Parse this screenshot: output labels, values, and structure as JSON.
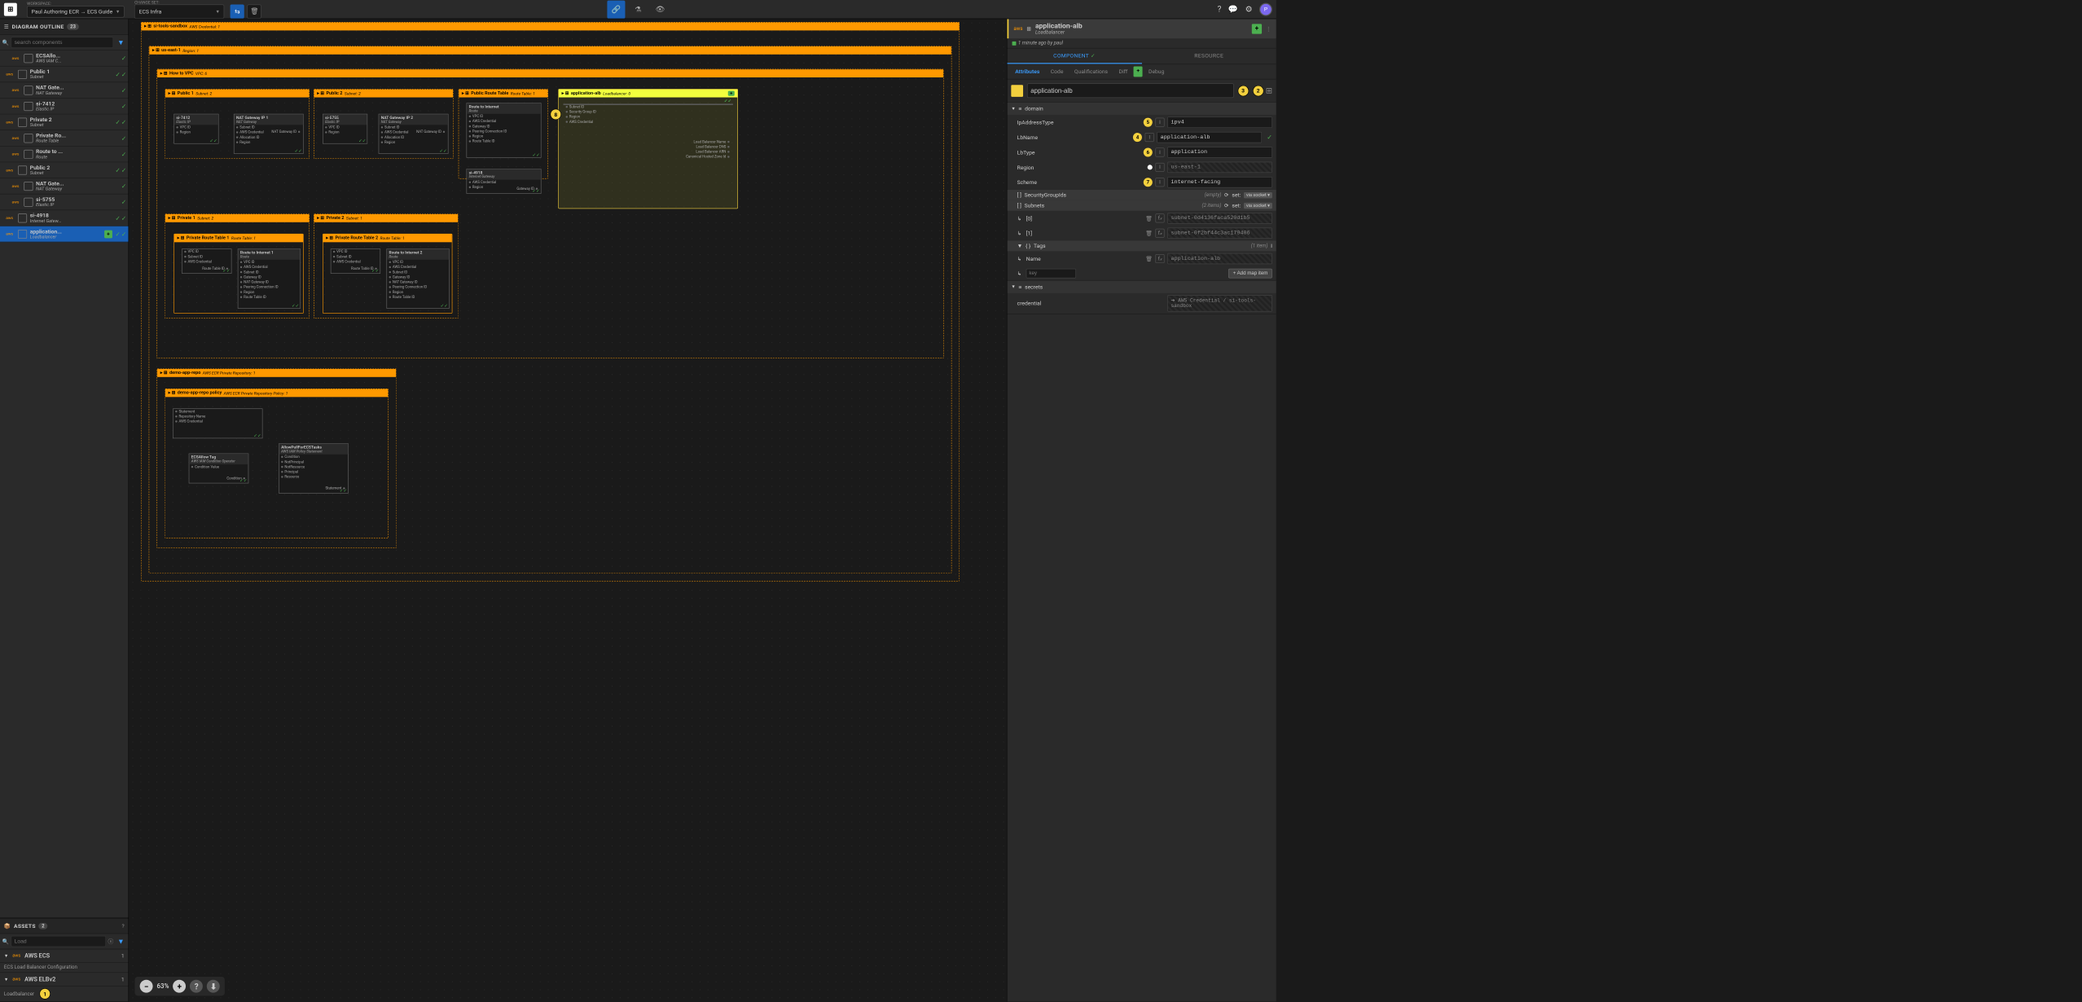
{
  "topbar": {
    "workspace_label": "WORKSPACE:",
    "workspace_name": "Paul Authoring ECR → ECS Guide",
    "changeset_label": "CHANGE SET:",
    "changeset_name": "ECS Infra",
    "avatar_letter": "P"
  },
  "outline": {
    "title": "DIAGRAM OUTLINE",
    "count": "23",
    "search_placeholder": "search components",
    "items": [
      {
        "name": "ECSAllo...",
        "sub": "AWS IAM C...",
        "indent": 1
      },
      {
        "name": "Public 1",
        "sub": "Subnet",
        "indent": 0
      },
      {
        "name": "NAT Gate...",
        "sub": "NAT Gateway",
        "indent": 1
      },
      {
        "name": "si-7412",
        "sub": "Elastic IP",
        "indent": 1
      },
      {
        "name": "Private 2",
        "sub": "Subnet",
        "indent": 0
      },
      {
        "name": "Private Ro...",
        "sub": "Route Table",
        "indent": 1
      },
      {
        "name": "Route to ...",
        "sub": "Route",
        "indent": 1
      },
      {
        "name": "Public 2",
        "sub": "Subnet",
        "indent": 0
      },
      {
        "name": "NAT Gate...",
        "sub": "NAT Gateway",
        "indent": 1
      },
      {
        "name": "si-5755",
        "sub": "Elastic IP",
        "indent": 1
      },
      {
        "name": "si-4918",
        "sub": "Internet Gatew...",
        "indent": 0
      },
      {
        "name": "application...",
        "sub": "Loadbalancer",
        "indent": 0,
        "selected": true,
        "plus": true
      }
    ]
  },
  "assets": {
    "title": "ASSETS",
    "count": "2",
    "search_placeholder": "Load",
    "categories": [
      {
        "name": "AWS ECS",
        "count": "1",
        "sub": "ECS Load Balancer Configuration"
      },
      {
        "name": "AWS ELBv2",
        "count": "1",
        "sub": "Loadbalancer",
        "marker": "1"
      }
    ]
  },
  "canvas": {
    "zoom": "63%",
    "markers": {
      "m8": "8"
    },
    "frames": {
      "sandbox": {
        "name": "si-tools-sandbox",
        "sub": "AWS Credential: 1"
      },
      "region": {
        "name": "us-east-1",
        "sub": "Region: 1"
      },
      "vpc": {
        "name": "How to VPC",
        "sub": "VPC: 6"
      },
      "public1": {
        "name": "Public 1",
        "sub": "Subnet: 2"
      },
      "public2": {
        "name": "Public 2",
        "sub": "Subnet: 2"
      },
      "pubrt": {
        "name": "Public Route Table",
        "sub": "Route Table: 1"
      },
      "alb": {
        "name": "application-alb",
        "sub": "Loadbalancer: 0"
      },
      "private1": {
        "name": "Private 1",
        "sub": "Subnet: 2"
      },
      "private2": {
        "name": "Private 2",
        "sub": "Subnet: 1"
      },
      "prt1": {
        "name": "Private Route Table 1",
        "sub": "Route Table: 1"
      },
      "prt2": {
        "name": "Private Route Table 2",
        "sub": "Route Table: 1"
      },
      "repo": {
        "name": "demo-app-repo",
        "sub": "AWS ECR Private Repository: 1"
      },
      "policy": {
        "name": "demo-app-repo policy",
        "sub": "AWS ECR Private Repository Policy: 1"
      }
    },
    "nodes": {
      "si7412": {
        "n": "si-7412",
        "s": "Elastic IP",
        "ports": [
          "VPC ID",
          "Region"
        ]
      },
      "natgw1": {
        "n": "NAT Gateway IP 1",
        "s": "NAT Gateway",
        "ports": [
          "Subnet ID",
          "AWS Credential",
          "Allocation ID",
          "Region"
        ],
        "out": [
          "NAT Gateway ID"
        ]
      },
      "si5755": {
        "n": "si-5755",
        "s": "Elastic IP",
        "ports": [
          "VPC ID",
          "Region"
        ]
      },
      "natgw2": {
        "n": "NAT Gateway IP 2",
        "s": "NAT Gateway",
        "ports": [
          "Subnet ID",
          "AWS Credential",
          "Allocation ID",
          "Region"
        ],
        "out": [
          "NAT Gateway ID"
        ]
      },
      "rtint": {
        "n": "Route to Internet",
        "s": "Route",
        "ports": [
          "VPC ID",
          "AWS Credential",
          "Gateway ID",
          "Peering Connection ID",
          "Region",
          "Route Table ID"
        ]
      },
      "si4918": {
        "n": "si-4918",
        "s": "Internet Gateway",
        "ports": [
          "AWS Credential",
          "Region"
        ],
        "out": [
          "Gateway ID"
        ]
      },
      "albnode": {
        "ports": [
          "Subnet ID",
          "Security Group ID",
          "Region",
          "AWS Credential"
        ],
        "out": [
          "Load Balancer Name",
          "Load Balancer DNS",
          "Load Balancer ARN",
          "Canonical Hosted Zone Id"
        ]
      },
      "rti1": {
        "n": "Route to Internet 1",
        "s": "Route",
        "ports": [
          "VPC ID",
          "AWS Credential",
          "Subnet ID",
          "Gateway ID",
          "NAT Gateway ID",
          "Peering Connection ID",
          "Region",
          "Route Table ID"
        ]
      },
      "rti2": {
        "n": "Route to Internet 2",
        "s": "Route",
        "ports": [
          "VPC ID",
          "AWS Credential",
          "Subnet ID",
          "Gateway ID",
          "NAT Gateway ID",
          "Peering Connection ID",
          "Region",
          "Route Table ID"
        ]
      },
      "privrt1b": {
        "ports": [
          "VPC ID",
          "Subnet ID",
          "AWS Credential"
        ],
        "out": [
          "Route Table ID"
        ]
      },
      "privrt2b": {
        "ports": [
          "VPC ID",
          "Subnet ID",
          "AWS Credential"
        ],
        "out": [
          "Route Table ID"
        ]
      },
      "ecstag": {
        "n": "ECSAllow Tag",
        "s": "AWS IAM Condition Operator",
        "ports": [
          "Condition Value"
        ],
        "out": [
          "Condition"
        ]
      },
      "allowpull": {
        "n": "AllowPullForECSTasks",
        "s": "AWS IAM Policy Statement",
        "ports": [
          "Condition",
          "NotPrincipal",
          "NotResource",
          "Principal",
          "Resource"
        ],
        "out": [
          "Statement"
        ]
      },
      "policybody": {
        "ports": [
          "Statement",
          "Repository Name",
          "AWS Credential"
        ]
      }
    }
  },
  "details": {
    "name": "application-alb",
    "type": "Loadbalancer",
    "status": "1 minute ago by paul",
    "tabs": {
      "component": "COMPONENT",
      "resource": "RESOURCE"
    },
    "subtabs": {
      "attributes": "Attributes",
      "code": "Code",
      "qualifications": "Qualifications",
      "diff": "Diff",
      "debug": "Debug"
    },
    "name_value": "application-alb",
    "markers": {
      "m2": "2",
      "m3": "3",
      "m4": "4",
      "m5": "5",
      "m6": "6",
      "m7": "7"
    },
    "sections": {
      "domain": {
        "label": "domain",
        "rows": [
          {
            "label": "IpAddressType",
            "marker": "5",
            "value": "ipv4"
          },
          {
            "label": "LbName",
            "marker": "4",
            "value": "application-alb",
            "check": true
          },
          {
            "label": "LbType",
            "marker": "6",
            "value": "application"
          },
          {
            "label": "Region",
            "value": "us-east-1",
            "disabled": true,
            "dot": true
          },
          {
            "label": "Scheme",
            "marker": "7",
            "value": "internet-facing"
          }
        ],
        "sgids": {
          "label": "SecurityGroupIds",
          "meta": "(empty)",
          "set": "set:",
          "badge": "via socket ▾"
        },
        "subnets": {
          "label": "Subnets",
          "meta": "(2 items)",
          "set": "set:",
          "badge": "via socket ▾",
          "items": [
            {
              "idx": "[0]",
              "value": "subnet-0d4136faca520d1b5"
            },
            {
              "idx": "[1]",
              "value": "subnet-0f2bf44c3ac179406"
            }
          ]
        },
        "tags": {
          "label": "Tags",
          "meta": "(1 item)",
          "items": [
            {
              "key": "Name",
              "value": "application-alb"
            }
          ],
          "key_placeholder": "key",
          "add_btn": "+ Add map item"
        }
      },
      "secrets": {
        "label": "secrets",
        "credential": {
          "label": "credential",
          "value": "➔ AWS Credential / si-tools-sandbox"
        }
      }
    }
  }
}
